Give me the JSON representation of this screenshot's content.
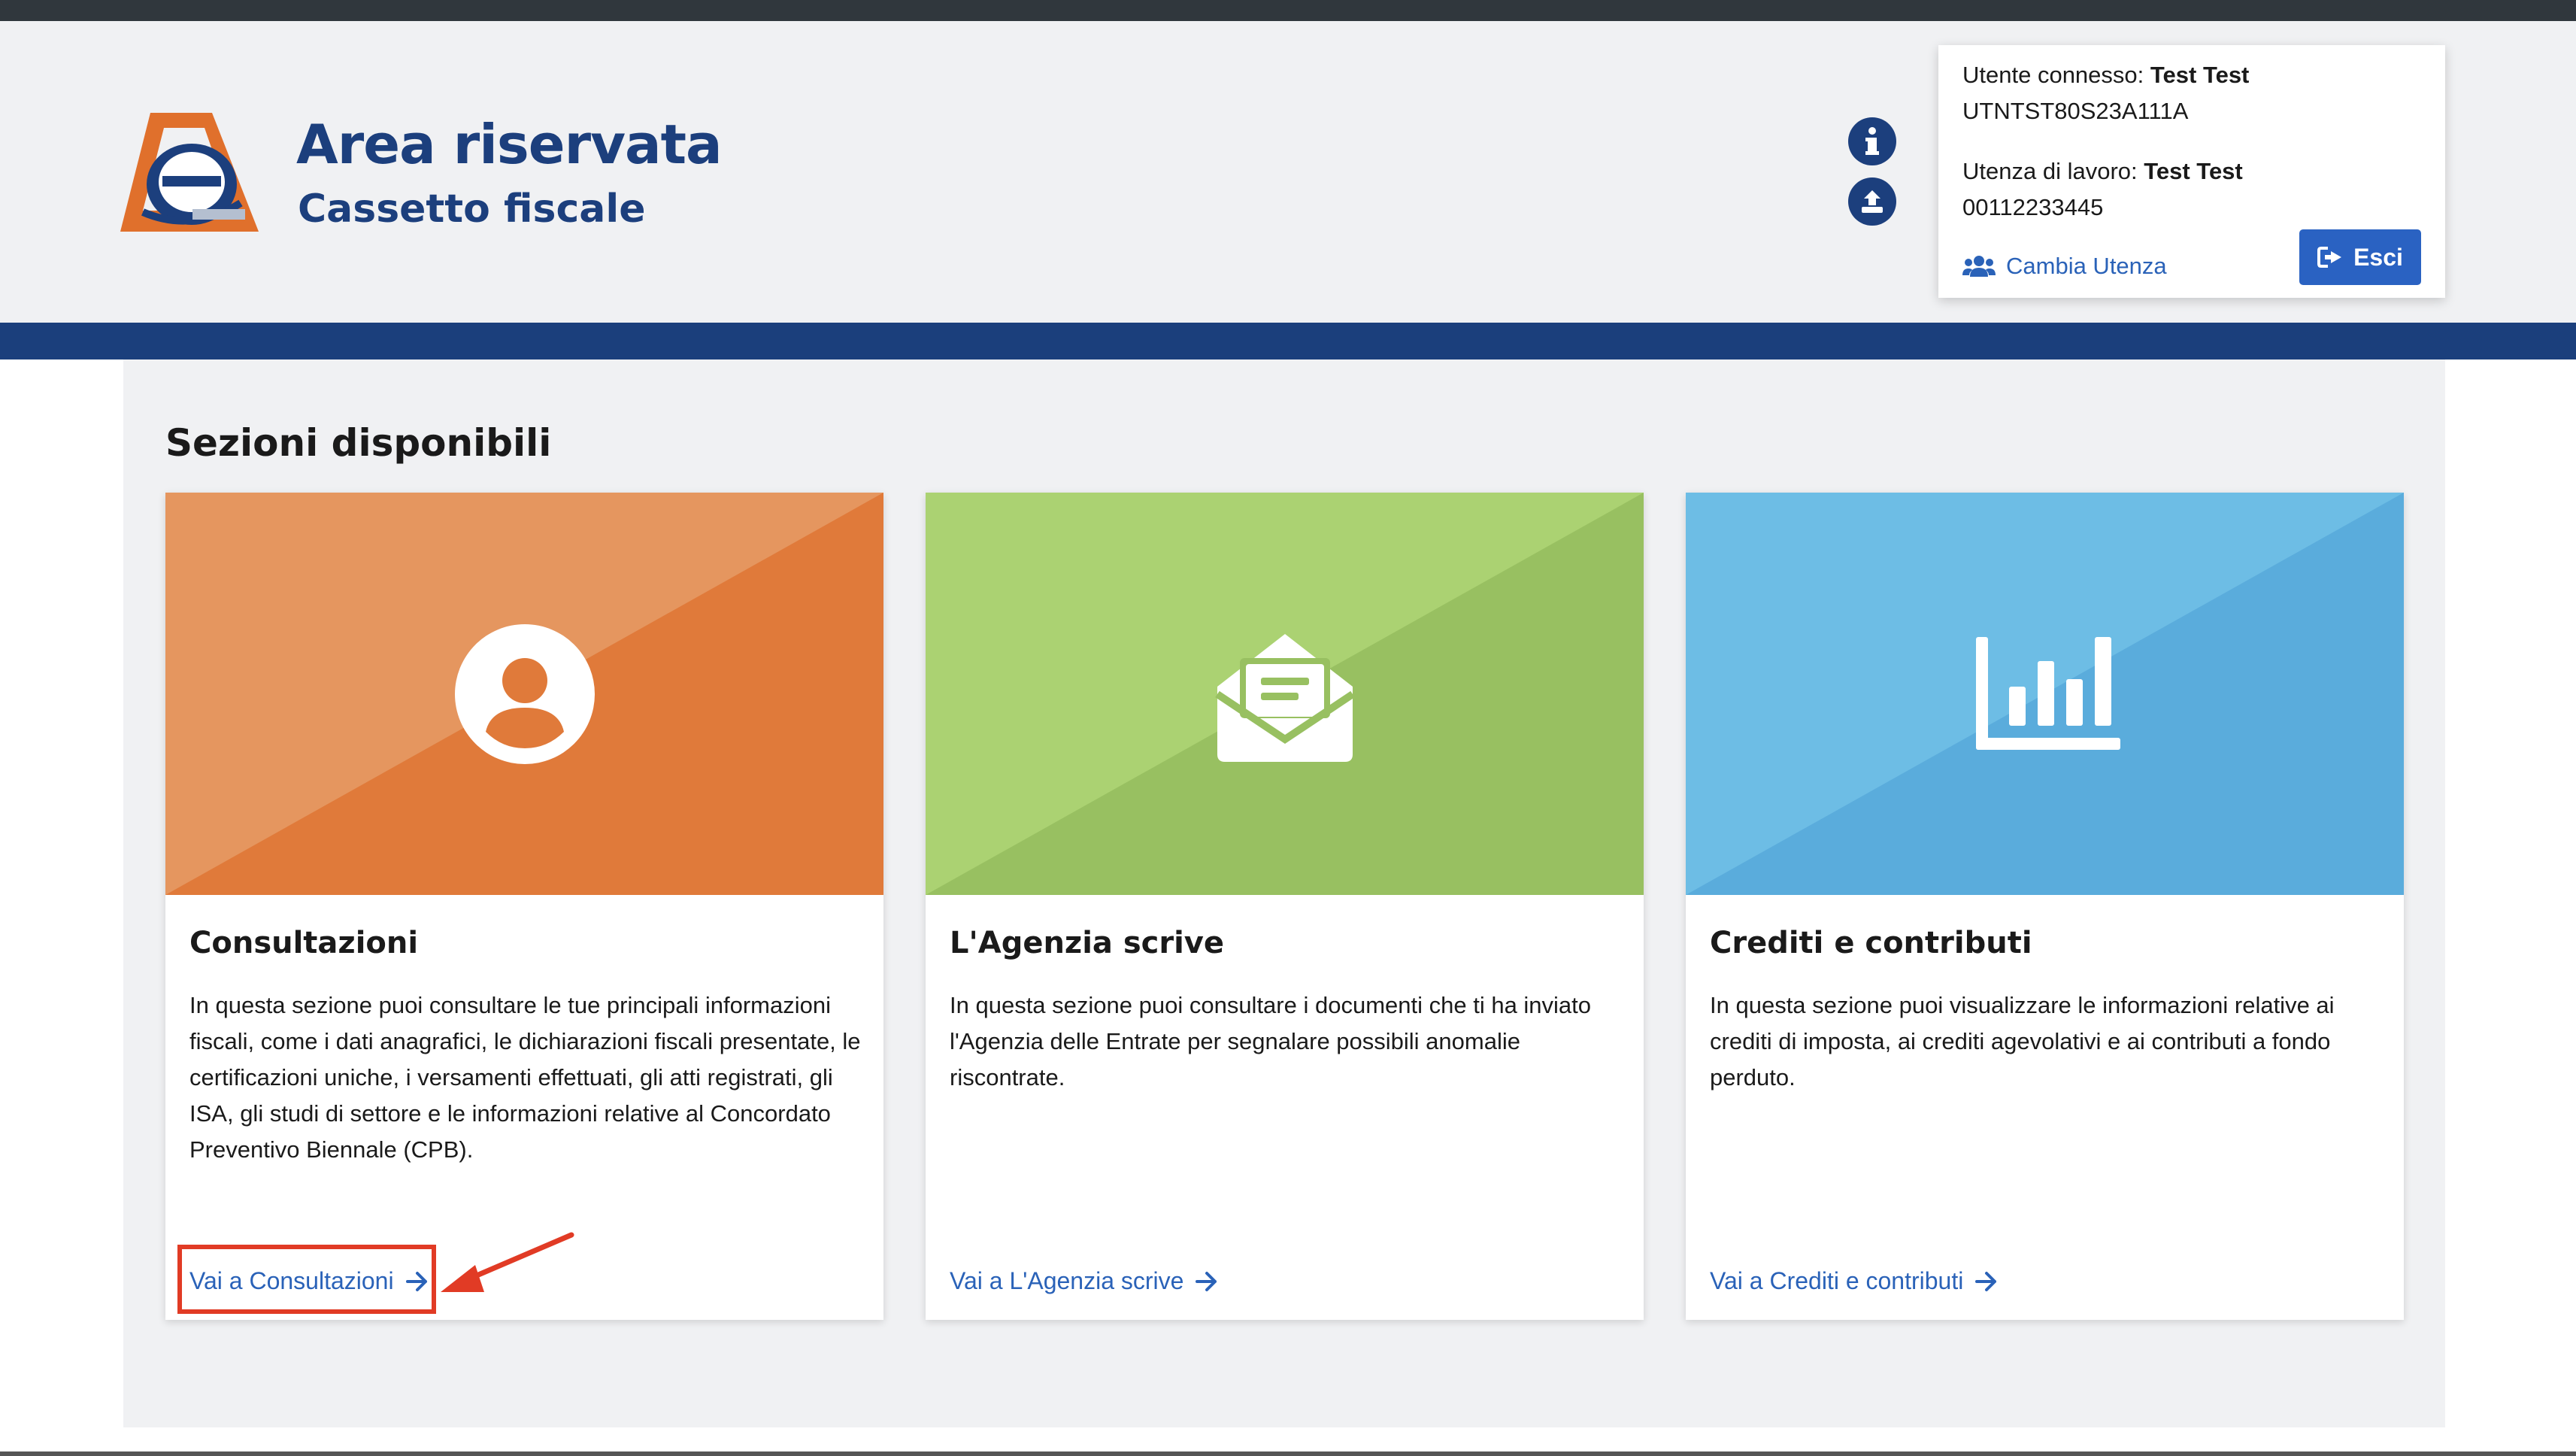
{
  "header": {
    "title": "Area riservata",
    "subtitle": "Cassetto fiscale"
  },
  "user_box": {
    "connected_label": "Utente connesso:",
    "connected_name": "Test Test",
    "connected_code": "UTNTST80S23A111A",
    "work_label": "Utenza di lavoro:",
    "work_name": "Test Test",
    "work_code": "00112233445",
    "switch_label": "Cambia Utenza",
    "logout_label": "Esci"
  },
  "main": {
    "section_title": "Sezioni disponibili",
    "cards": [
      {
        "title": "Consultazioni",
        "description": "In questa sezione puoi consultare le tue principali informazioni fiscali, come i dati anagrafici, le dichiarazioni fiscali presentate, le certificazioni uniche, i versamenti effettuati, gli atti registrati, gli ISA, gli studi di settore e le informazioni relative al Concordato Preventivo Biennale (CPB).",
        "link": "Vai a Consultazioni",
        "icon": "user-circle-icon",
        "color": "#e07a3a"
      },
      {
        "title": "L'Agenzia scrive",
        "description": "In questa sezione puoi consultare i documenti che ti ha inviato l'Agenzia delle Entrate per segnalare possibili anomalie riscontrate.",
        "link": "Vai a L'Agenzia scrive",
        "icon": "open-envelope-icon",
        "color": "#98c061"
      },
      {
        "title": "Crediti e contributi",
        "description": "In questa sezione puoi visualizzare le informazioni relative ai crediti di imposta, ai crediti agevolativi e ai contributi a fondo perduto.",
        "link": "Vai a Crediti e contributi",
        "icon": "bar-chart-icon",
        "color": "#5aacdc"
      }
    ]
  },
  "annotation": {
    "highlight_color": "#e13b25"
  }
}
